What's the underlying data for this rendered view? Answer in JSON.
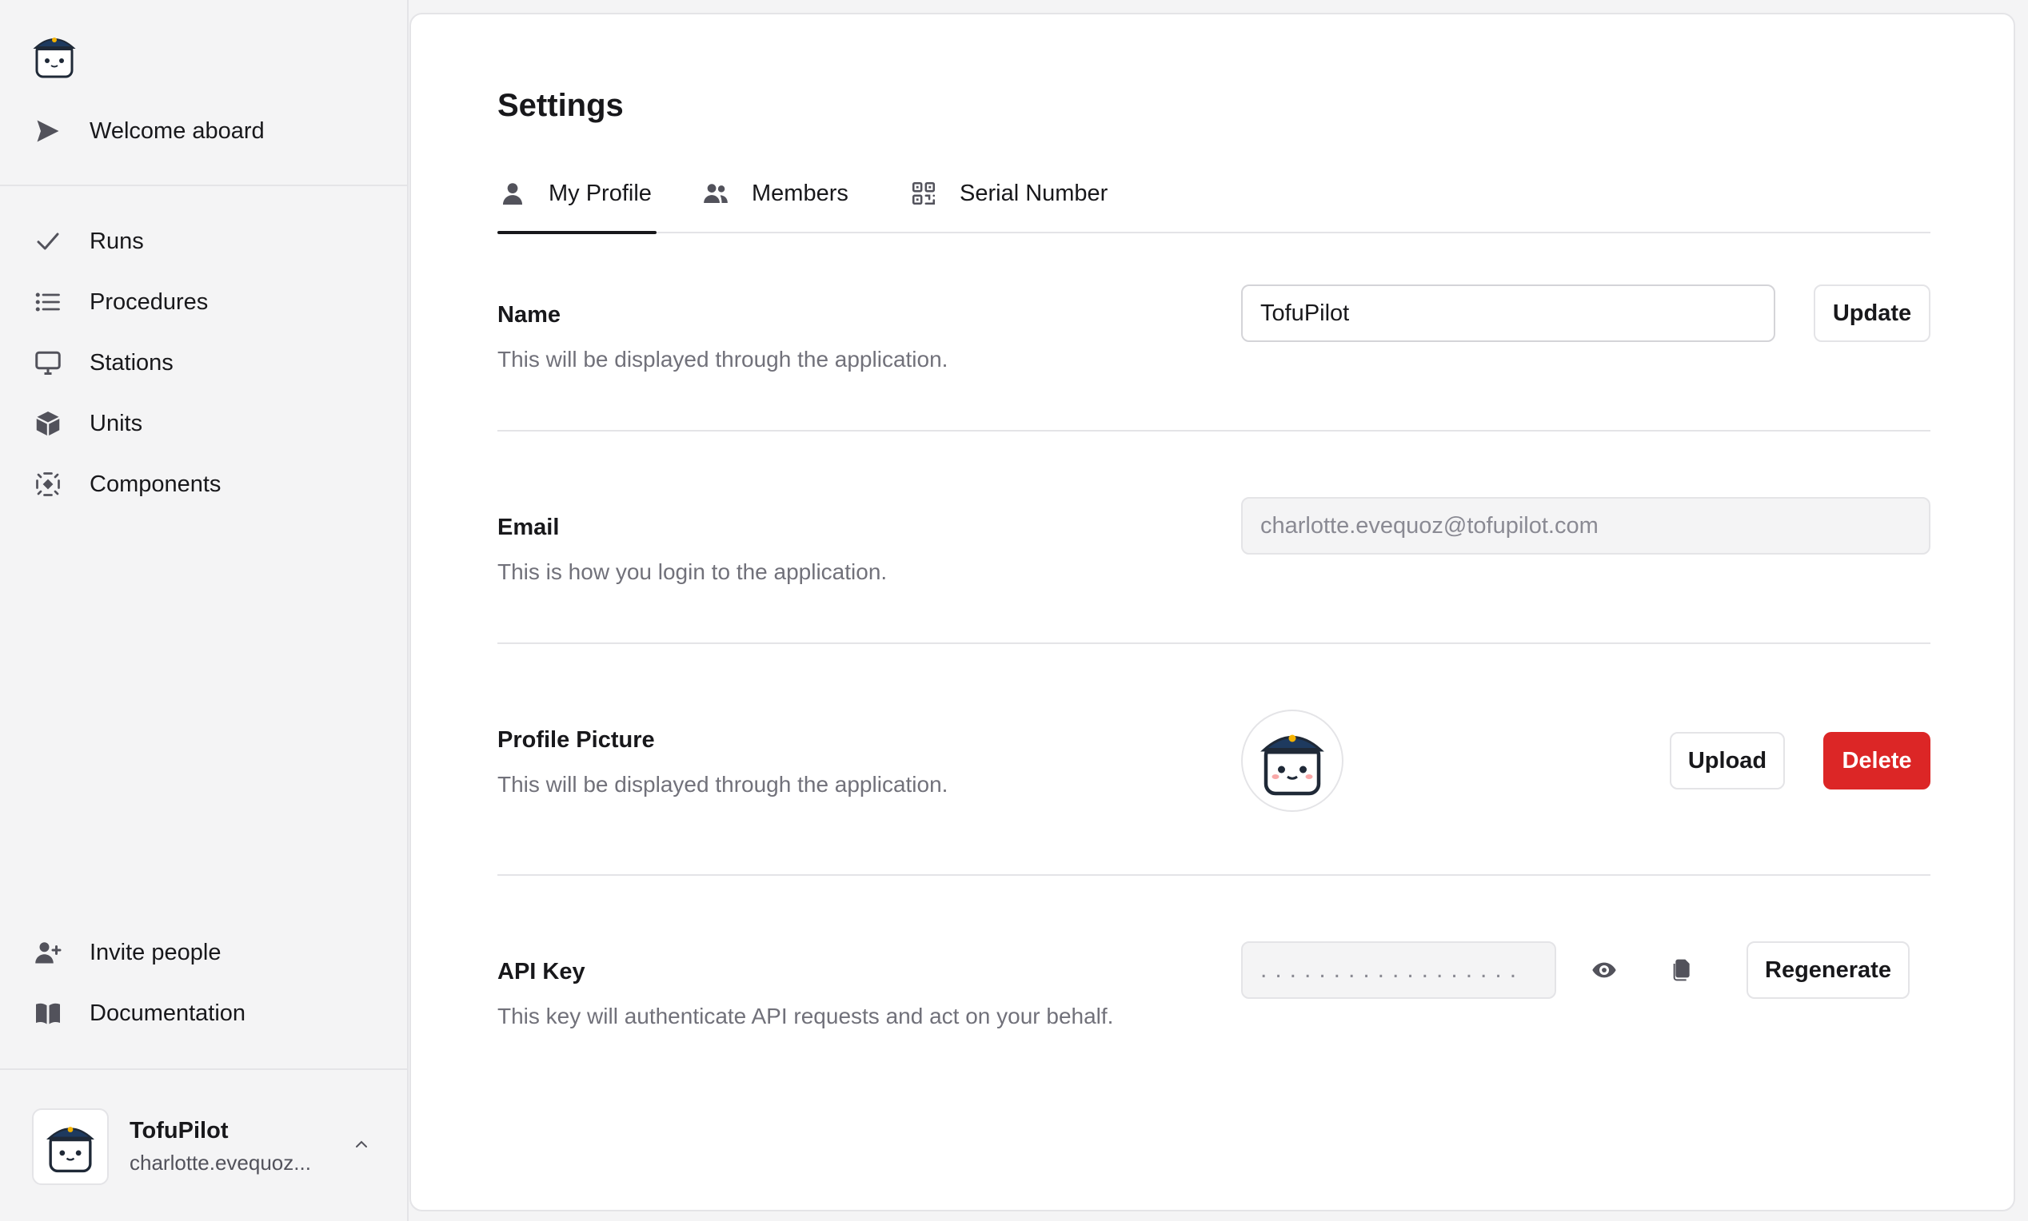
{
  "sidebar": {
    "logo": "tofupilot-mascot-logo",
    "welcome": {
      "label": "Welcome aboard",
      "icon": "send-icon"
    },
    "items": [
      {
        "label": "Runs",
        "icon": "check-icon"
      },
      {
        "label": "Procedures",
        "icon": "list-icon"
      },
      {
        "label": "Stations",
        "icon": "monitor-icon"
      },
      {
        "label": "Units",
        "icon": "box-icon"
      },
      {
        "label": "Components",
        "icon": "component-icon"
      }
    ],
    "bottom_items": [
      {
        "label": "Invite people",
        "icon": "user-plus-icon"
      },
      {
        "label": "Documentation",
        "icon": "book-icon"
      }
    ],
    "account": {
      "name": "TofuPilot",
      "email": "charlotte.evequoz..."
    }
  },
  "page": {
    "title": "Settings",
    "tabs": [
      {
        "label": "My Profile",
        "icon": "user-icon",
        "active": true
      },
      {
        "label": "Members",
        "icon": "users-icon",
        "active": false
      },
      {
        "label": "Serial Number",
        "icon": "qr-code-icon",
        "active": false
      }
    ]
  },
  "name_section": {
    "label": "Name",
    "description": "This will be displayed through the application.",
    "value": "TofuPilot",
    "button": "Update"
  },
  "email_section": {
    "label": "Email",
    "description": "This is how you login to the application.",
    "value": "charlotte.evequoz@tofupilot.com"
  },
  "picture_section": {
    "label": "Profile Picture",
    "description": "This will be displayed through the application.",
    "upload": "Upload",
    "delete": "Delete"
  },
  "api_section": {
    "label": "API Key",
    "description": "This key will authenticate API requests and act on your behalf.",
    "masked_value": "..................",
    "button": "Regenerate"
  },
  "colors": {
    "danger": "#dc2626",
    "text": "#18181b",
    "muted": "#71717a",
    "border": "#e4e4e7",
    "sidebar_bg": "#f4f4f5"
  }
}
